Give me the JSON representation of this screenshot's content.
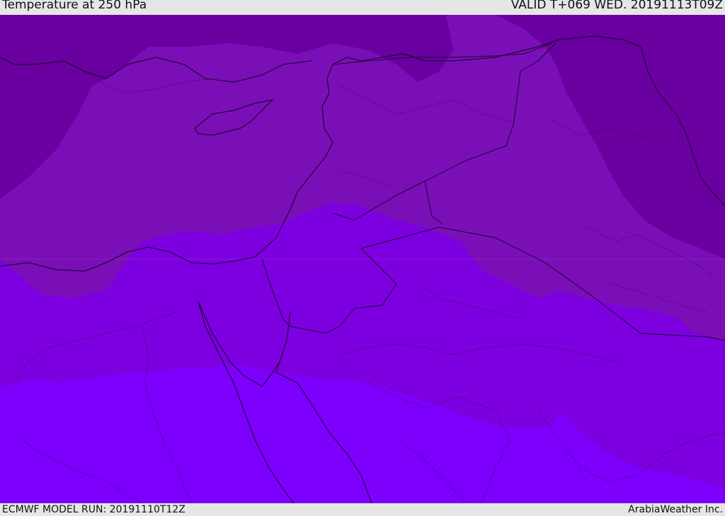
{
  "header": {
    "title": "Temperature at 250 hPa",
    "valid_time": "VALID T+069 WED. 20191113T09Z"
  },
  "footer": {
    "model_run": "ECMWF MODEL RUN: 20191110T12Z",
    "credit": "ArabiaWeather Inc."
  },
  "colors": {
    "band_coldest": "#69009f",
    "band_cold": "#7a0fb8",
    "band_mid": "#7d00e0",
    "band_warm": "#7c00fb",
    "borders": "#1a0630"
  }
}
